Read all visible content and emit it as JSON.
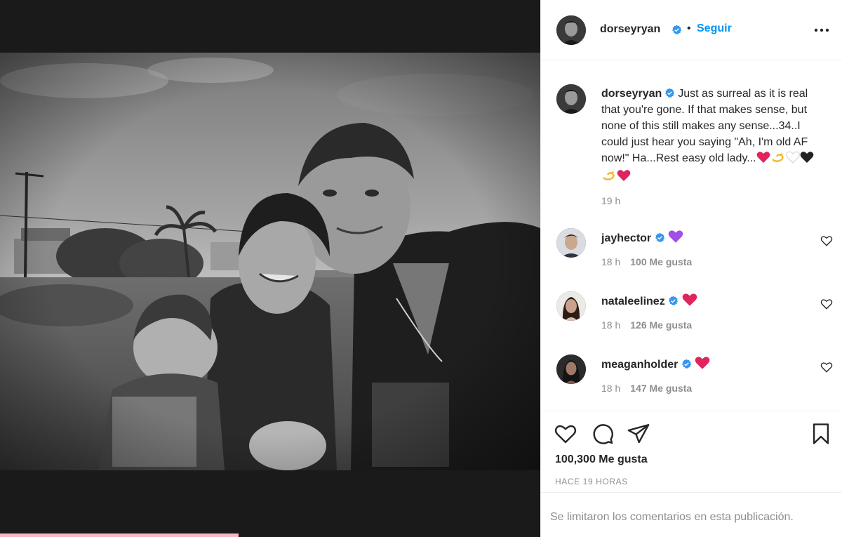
{
  "post": {
    "author": "dorseyryan",
    "follow_label": "Seguir",
    "separator": "•",
    "caption_text": "Just as surreal as it is real that you're gone. If that makes sense, but none of this still makes any sense...34..I could just hear you saying \"Ah, I'm old AF now!\" Ha...Rest easy old lady...",
    "caption_emojis": [
      "red-heart",
      "dizzy",
      "white-heart",
      "black-heart",
      "dizzy",
      "red-heart"
    ],
    "caption_time": "19 h",
    "likes_total": "100,300 Me gusta",
    "posted_ago": "HACE 19 HORAS",
    "comments_limited": "Se limitaron los comentarios en esta publicación."
  },
  "comments": [
    {
      "username": "jayhector",
      "emoji": "purple-heart",
      "time": "18 h",
      "likes": "100 Me gusta"
    },
    {
      "username": "nataleelinez",
      "emoji": "red-heart",
      "time": "18 h",
      "likes": "126 Me gusta"
    },
    {
      "username": "meaganholder",
      "emoji": "red-heart",
      "time": "18 h",
      "likes": "147 Me gusta"
    }
  ],
  "icons": {
    "more": "more-horizontal-icon",
    "like": "heart-outline-icon",
    "comment": "comment-bubble-icon",
    "share": "paper-plane-icon",
    "save": "bookmark-icon",
    "verified": "verified-badge-icon"
  },
  "colors": {
    "link_blue": "#0095f6",
    "verified_blue": "#3897f0",
    "muted_text": "#8e8e8e",
    "heart_red": "#ed4956",
    "purple_heart": "#a44ee8",
    "media_bg": "#1a1a1a"
  }
}
